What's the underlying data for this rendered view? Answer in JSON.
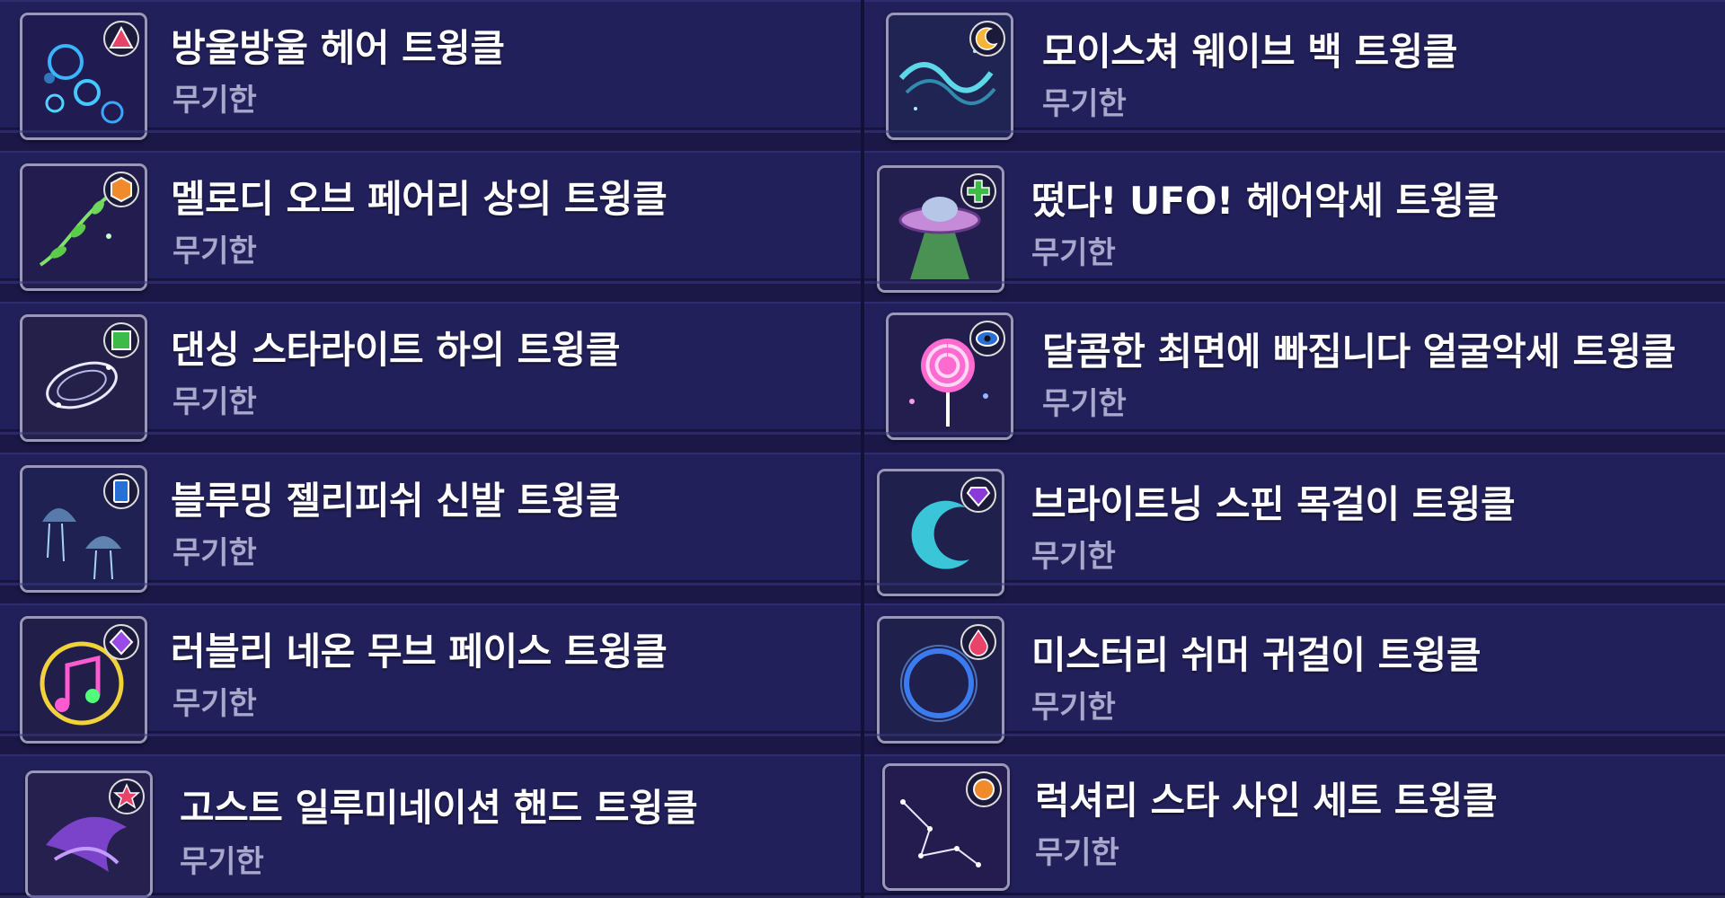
{
  "left_items": [
    {
      "title": "방울방울 헤어 트윙클",
      "duration": "무기한",
      "icon": "bubble-hair-icon",
      "badge_icon": "triangle-gem-icon"
    },
    {
      "title": "멜로디 오브 페어리 상의 트윙클",
      "duration": "무기한",
      "icon": "vine-top-icon",
      "badge_icon": "hexagon-gem-icon"
    },
    {
      "title": "댄싱 스타라이트 하의 트윙클",
      "duration": "무기한",
      "icon": "starlight-swirl-icon",
      "badge_icon": "square-gem-icon"
    },
    {
      "title": "블루밍 젤리피쉬 신발 트윙클",
      "duration": "무기한",
      "icon": "jellyfish-icon",
      "badge_icon": "card-gem-icon"
    },
    {
      "title": "러블리 네온 무브 페이스 트윙클",
      "duration": "무기한",
      "icon": "neon-music-note-icon",
      "badge_icon": "diamond-gem-icon"
    },
    {
      "title": "고스트 일루미네이션 핸드 트윙클",
      "duration": "무기한",
      "icon": "ghost-purple-icon",
      "badge_icon": "star-gem-icon"
    }
  ],
  "right_items": [
    {
      "title": "모이스쳐 웨이브 백 트윙클",
      "duration": "무기한",
      "icon": "wave-back-icon",
      "badge_icon": "moon-gem-icon"
    },
    {
      "title": "떴다! UFO! 헤어악세 트윙클",
      "duration": "무기한",
      "icon": "ufo-icon",
      "badge_icon": "cross-gem-icon"
    },
    {
      "title": "달콤한 최면에 빠집니다 얼굴악세 트윙클",
      "duration": "무기한",
      "icon": "swirl-lollipop-icon",
      "badge_icon": "eye-gem-icon"
    },
    {
      "title": "브라이트닝 스핀 목걸이 트윙클",
      "duration": "무기한",
      "icon": "crescent-ring-icon",
      "badge_icon": "amethyst-gem-icon"
    },
    {
      "title": "미스터리 쉬머 귀걸이 트윙클",
      "duration": "무기한",
      "icon": "blue-ring-icon",
      "badge_icon": "drop-gem-icon"
    },
    {
      "title": "럭셔리 스타 사인 세트 트윙클",
      "duration": "무기한",
      "icon": "constellation-icon",
      "badge_icon": "orb-gem-icon"
    }
  ]
}
